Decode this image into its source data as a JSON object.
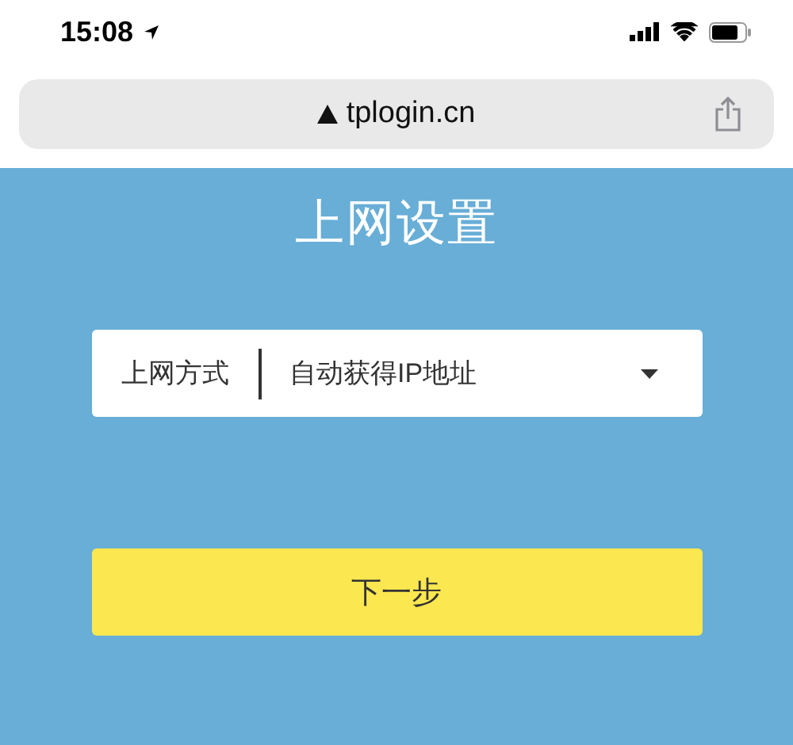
{
  "status_bar": {
    "time": "15:08"
  },
  "address_bar": {
    "url": "tplogin.cn"
  },
  "page": {
    "title": "上网设置",
    "field": {
      "label": "上网方式",
      "value": "自动获得IP地址"
    },
    "next_button": "下一步"
  }
}
